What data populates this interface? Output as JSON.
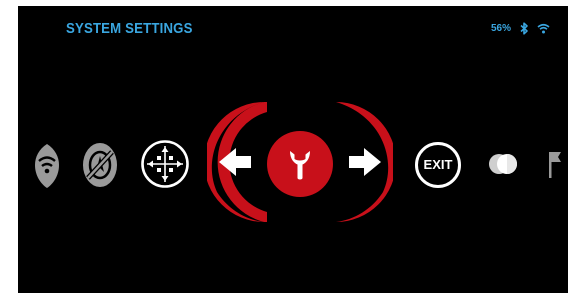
{
  "header": {
    "title": "SYSTEM SETTINGS",
    "battery_percent": "56%",
    "bluetooth_icon": "bluetooth-icon",
    "wifi_icon": "wifi-icon"
  },
  "colors": {
    "title": "#3aa6e0",
    "status": "#3aa6e0",
    "accent_red": "#c8101a",
    "icon_grey": "#9a9a9a",
    "icon_white": "#ffffff"
  },
  "carousel": {
    "items": [
      {
        "icon": "wifi-badge-icon"
      },
      {
        "icon": "no-compass-icon"
      },
      {
        "icon": "reticle-adjust-icon"
      },
      {
        "icon": "previous-arrow-icon"
      },
      {
        "icon": "settings-wrench-icon",
        "selected": true
      },
      {
        "icon": "next-arrow-icon"
      },
      {
        "icon": "exit-icon",
        "label": "EXIT"
      },
      {
        "icon": "contrast-icon"
      },
      {
        "icon": "flag-icon"
      }
    ]
  }
}
